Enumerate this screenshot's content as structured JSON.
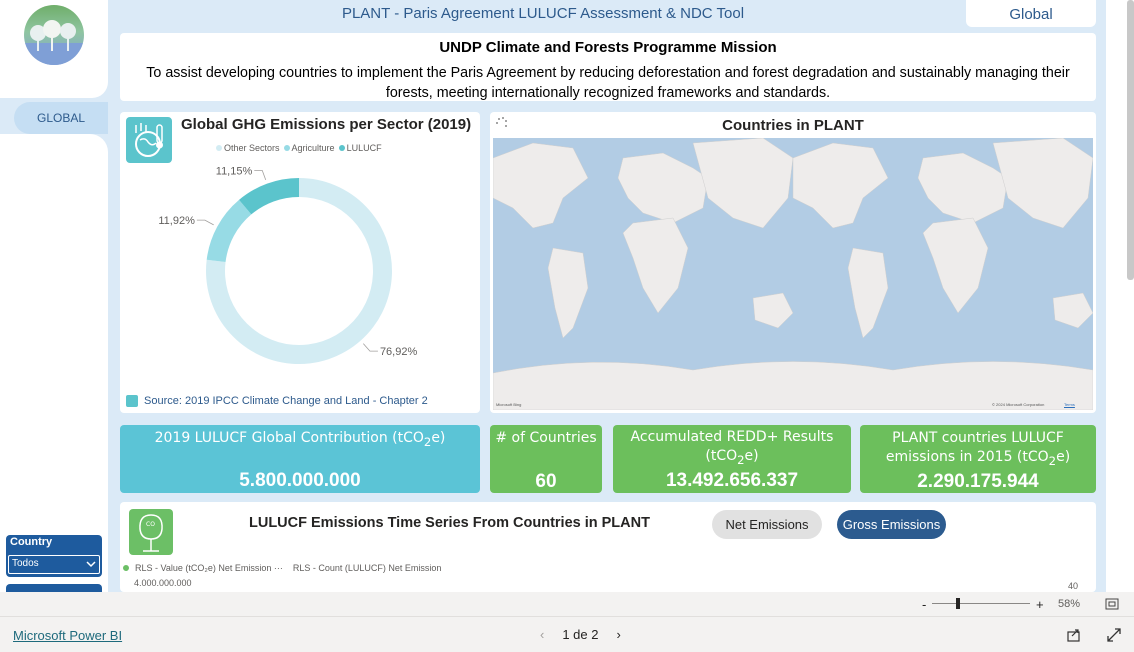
{
  "header": {
    "title": "PLANT - Paris Agreement LULUCF Assessment & NDC Tool",
    "global_button": "Global"
  },
  "sidebar": {
    "tab_label": "GLOBAL",
    "country_slicer": {
      "title": "Country",
      "selected": "Todos"
    }
  },
  "mission": {
    "title": "UNDP Climate and Forests Programme Mission",
    "text": "To assist developing countries to implement the Paris Agreement by reducing deforestation and forest degradation and sustainably managing their forests, meeting internationally recognized frameworks and standards."
  },
  "sector_chart": {
    "title": "Global GHG Emissions per Sector (2019)",
    "source": "Source: 2019 IPCC Climate Change and Land - Chapter 2"
  },
  "map": {
    "title": "Countries in PLANT",
    "attribution_left": "Microsoft Bing",
    "attribution_right": "© 2024 Microsoft Corporation",
    "terms": "Terms"
  },
  "kpis": [
    {
      "label_pre": "2019 LULUCF Global Contribution (tCO",
      "label_sub": "2",
      "label_post": "e)",
      "value": "5.800.000.000",
      "color": "#5bc4d6"
    },
    {
      "label_pre": "# of Countries",
      "label_sub": "",
      "label_post": "",
      "value": "60",
      "color": "#6cbf5c"
    },
    {
      "label_pre": "Accumulated REDD+ Results (tCO",
      "label_sub": "2",
      "label_post": "e)",
      "value": "13.492.656.337",
      "color": "#6cbf5c"
    },
    {
      "label_pre": "PLANT countries LULUCF emissions in 2015 (tCO",
      "label_sub": "2",
      "label_post": "e)",
      "value": "2.290.175.944",
      "color": "#6cbf5c"
    }
  ],
  "timeseries": {
    "title": "LULUCF Emissions Time Series From Countries in PLANT",
    "net_button": "Net Emissions",
    "gross_button": "Gross Emissions",
    "legend_1": "RLS - Value (tCO₂e) Net Emission ···",
    "legend_2": "RLS - Count (LULUCF) Net Emission",
    "y_left_top": "4.000.000.000",
    "y_right_top": "40"
  },
  "footer": {
    "zoom": "58%",
    "brand_link": "Microsoft Power BI",
    "page_indicator": "1 de 2"
  },
  "chart_data": {
    "type": "pie",
    "title": "Global GHG Emissions per Sector (2019)",
    "categories": [
      "Other Sectors",
      "Agriculture",
      "LULUCF"
    ],
    "values": [
      76.92,
      11.92,
      11.15
    ],
    "labels": [
      "76,92%",
      "11,92%",
      "11,15%"
    ],
    "colors": [
      "#d3ecf3",
      "#97dbe5",
      "#5bc4cc"
    ],
    "legend": "top"
  }
}
